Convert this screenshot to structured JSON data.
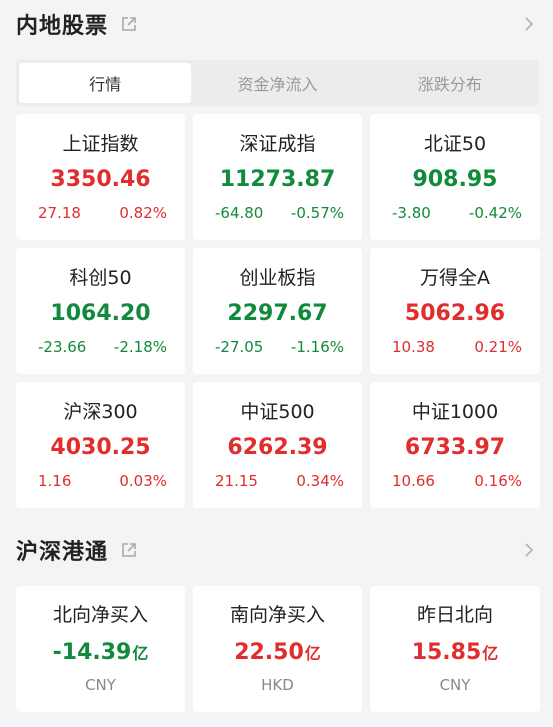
{
  "mainland": {
    "title": "内地股票",
    "tabs": [
      {
        "label": "行情",
        "active": true
      },
      {
        "label": "资金净流入",
        "active": false
      },
      {
        "label": "涨跌分布",
        "active": false
      }
    ],
    "indices": [
      {
        "name": "上证指数",
        "value": "3350.46",
        "change": "27.18",
        "pct": "0.82%",
        "dir": "up"
      },
      {
        "name": "深证成指",
        "value": "11273.87",
        "change": "-64.80",
        "pct": "-0.57%",
        "dir": "down"
      },
      {
        "name": "北证50",
        "value": "908.95",
        "change": "-3.80",
        "pct": "-0.42%",
        "dir": "down"
      },
      {
        "name": "科创50",
        "value": "1064.20",
        "change": "-23.66",
        "pct": "-2.18%",
        "dir": "down"
      },
      {
        "name": "创业板指",
        "value": "2297.67",
        "change": "-27.05",
        "pct": "-1.16%",
        "dir": "down"
      },
      {
        "name": "万得全A",
        "value": "5062.96",
        "change": "10.38",
        "pct": "0.21%",
        "dir": "up"
      },
      {
        "name": "沪深300",
        "value": "4030.25",
        "change": "1.16",
        "pct": "0.03%",
        "dir": "up"
      },
      {
        "name": "中证500",
        "value": "6262.39",
        "change": "21.15",
        "pct": "0.34%",
        "dir": "up"
      },
      {
        "name": "中证1000",
        "value": "6733.97",
        "change": "10.66",
        "pct": "0.16%",
        "dir": "up"
      }
    ]
  },
  "connect": {
    "title": "沪深港通",
    "items": [
      {
        "name": "北向净买入",
        "value": "-14.39",
        "unit": "亿",
        "currency": "CNY",
        "dir": "down"
      },
      {
        "name": "南向净买入",
        "value": "22.50",
        "unit": "亿",
        "currency": "HKD",
        "dir": "up"
      },
      {
        "name": "昨日北向",
        "value": "15.85",
        "unit": "亿",
        "currency": "CNY",
        "dir": "up"
      }
    ]
  },
  "colors": {
    "up": "#e02d2d",
    "down": "#118a3b"
  },
  "icons": {
    "share": "external-link-icon",
    "more": "chevron-right-icon"
  }
}
